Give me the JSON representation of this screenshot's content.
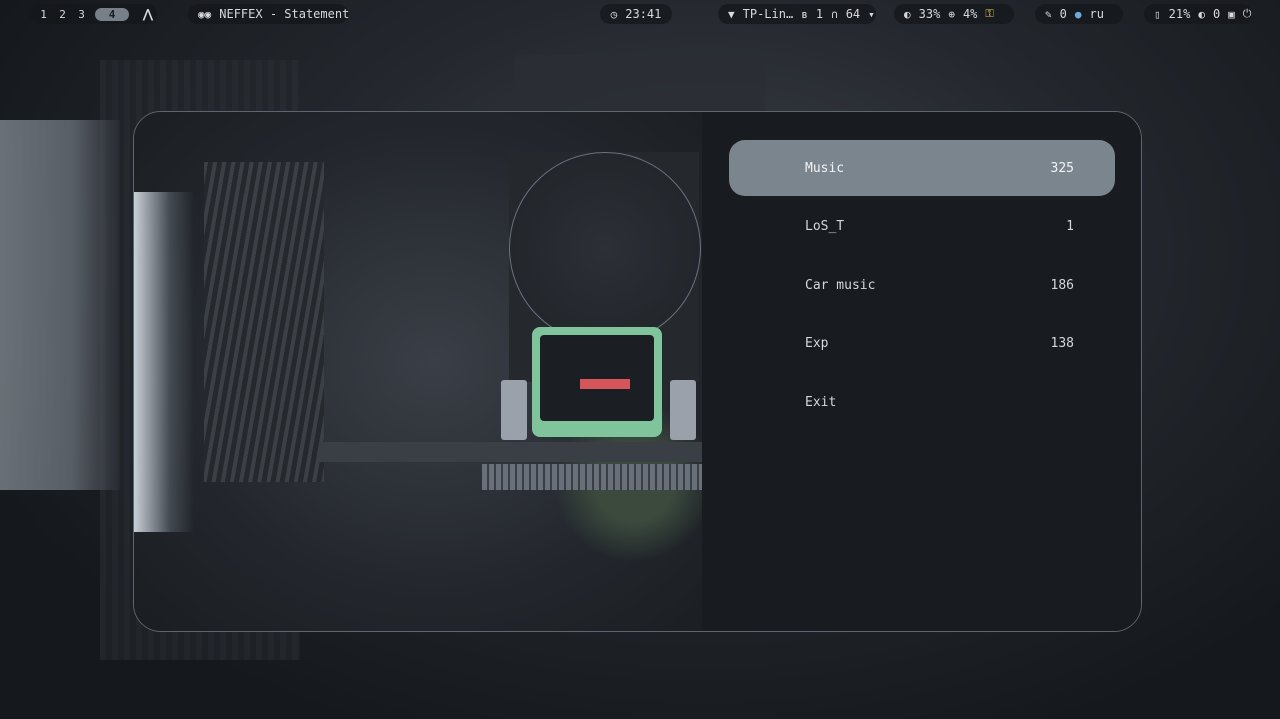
{
  "topbar": {
    "workspaces": [
      "1",
      "2",
      "3",
      "4"
    ],
    "active_workspace": "4",
    "distro_logo": "arch-icon",
    "media": {
      "icon": "spotify-icon",
      "text": "NEFFEX - Statement"
    },
    "clock": {
      "icon": "clock-icon",
      "time": "23:41"
    },
    "network": {
      "wifi_label": "TP-Lin…",
      "bluetooth_count": "1",
      "volume": "64"
    },
    "system": {
      "brightness": "33%",
      "cpu": "4%"
    },
    "lang": {
      "notifications": "0",
      "layout": "ru"
    },
    "battery": {
      "level": "21%",
      "idle_inhibit": "0"
    }
  },
  "launcher": {
    "selected_index": 0,
    "items": [
      {
        "name": "Music",
        "count": "325"
      },
      {
        "name": "LoS_T",
        "count": "1"
      },
      {
        "name": "Car music",
        "count": "186"
      },
      {
        "name": "Exp",
        "count": "138"
      },
      {
        "name": "Exit",
        "count": ""
      }
    ]
  },
  "colors": {
    "bar_bg": "#14171b",
    "selected_item": "#7b858e",
    "launcher_bg": "#181b1f",
    "border": "#5d6670"
  }
}
